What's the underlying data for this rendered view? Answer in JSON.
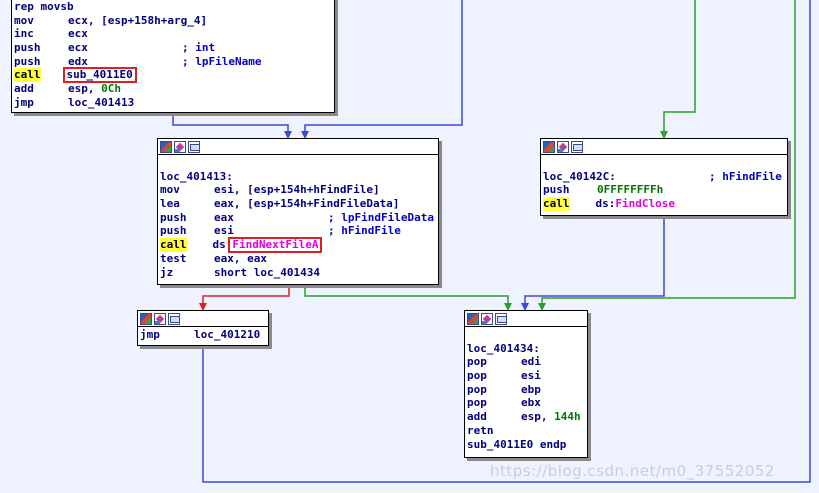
{
  "colors": {
    "background": "#eff3ff",
    "edge_unconditional": "#3a4ad8",
    "edge_true": "#2ca02c",
    "edge_false": "#e02020",
    "highlight_box": "#e02020",
    "call_highlight": "#ffff40"
  },
  "node_icons": [
    "graph-overview-icon",
    "node-color-icon",
    "rename-node-icon"
  ],
  "node1": {
    "lines": [
      {
        "mn": "rep movsb",
        "op": "",
        "cm": ""
      },
      {
        "mn": "mov",
        "op": "ecx, [esp+158h+arg_4]",
        "cm": ""
      },
      {
        "mn": "inc",
        "op": "ecx",
        "cm": ""
      },
      {
        "mn": "push",
        "op": "ecx",
        "cm": "; int"
      },
      {
        "mn": "push",
        "op": "edx",
        "cm": "; lpFileName"
      },
      {
        "mn": "call",
        "op": "sub_4011E0",
        "cm": ""
      },
      {
        "mn": "add",
        "op": "esp, ",
        "num": "0Ch",
        "cm": ""
      },
      {
        "mn": "jmp",
        "op": "loc_401413",
        "cm": ""
      }
    ]
  },
  "node2": {
    "lines": [
      {
        "mn": "",
        "op": "",
        "cm": ""
      },
      {
        "mn": "loc_401413:",
        "op": "",
        "cm": ""
      },
      {
        "mn": "mov",
        "op": "esi, [esp+154h+hFindFile]",
        "cm": ""
      },
      {
        "mn": "lea",
        "op": "eax, [esp+154h+FindFileData]",
        "cm": ""
      },
      {
        "mn": "push",
        "op": "eax",
        "cm": "; lpFindFileData"
      },
      {
        "mn": "push",
        "op": "esi",
        "cm": "; hFindFile"
      },
      {
        "mn": "call",
        "op": "ds:",
        "fn": "FindNextFileA",
        "cm": ""
      },
      {
        "mn": "test",
        "op": "eax, eax",
        "cm": ""
      },
      {
        "mn": "jz",
        "op": "short loc_401434",
        "cm": ""
      }
    ]
  },
  "node3": {
    "lines": [
      {
        "mn": "",
        "op": "",
        "cm": ""
      },
      {
        "mn": "loc_40142C:",
        "op": "",
        "cm": "; hFindFile"
      },
      {
        "mn": "push",
        "op": "",
        "num": "0FFFFFFFFh",
        "cm": ""
      },
      {
        "mn": "call",
        "op": "ds:",
        "fn": "FindClose",
        "cm": ""
      }
    ]
  },
  "node4": {
    "lines": [
      {
        "mn": "jmp",
        "op": "loc_401210",
        "cm": ""
      }
    ]
  },
  "node5": {
    "lines": [
      {
        "mn": "",
        "op": "",
        "cm": ""
      },
      {
        "mn": "loc_401434:",
        "op": "",
        "cm": ""
      },
      {
        "mn": "pop",
        "op": "edi",
        "cm": ""
      },
      {
        "mn": "pop",
        "op": "esi",
        "cm": ""
      },
      {
        "mn": "pop",
        "op": "ebp",
        "cm": ""
      },
      {
        "mn": "pop",
        "op": "ebx",
        "cm": ""
      },
      {
        "mn": "add",
        "op": "esp, ",
        "num": "144h",
        "cm": ""
      },
      {
        "mn": "retn",
        "op": "",
        "cm": ""
      },
      {
        "mn": "sub_4011E0 endp",
        "op": "",
        "cm": ""
      }
    ]
  },
  "watermark": "https://blog.csdn.net/m0_37552052"
}
